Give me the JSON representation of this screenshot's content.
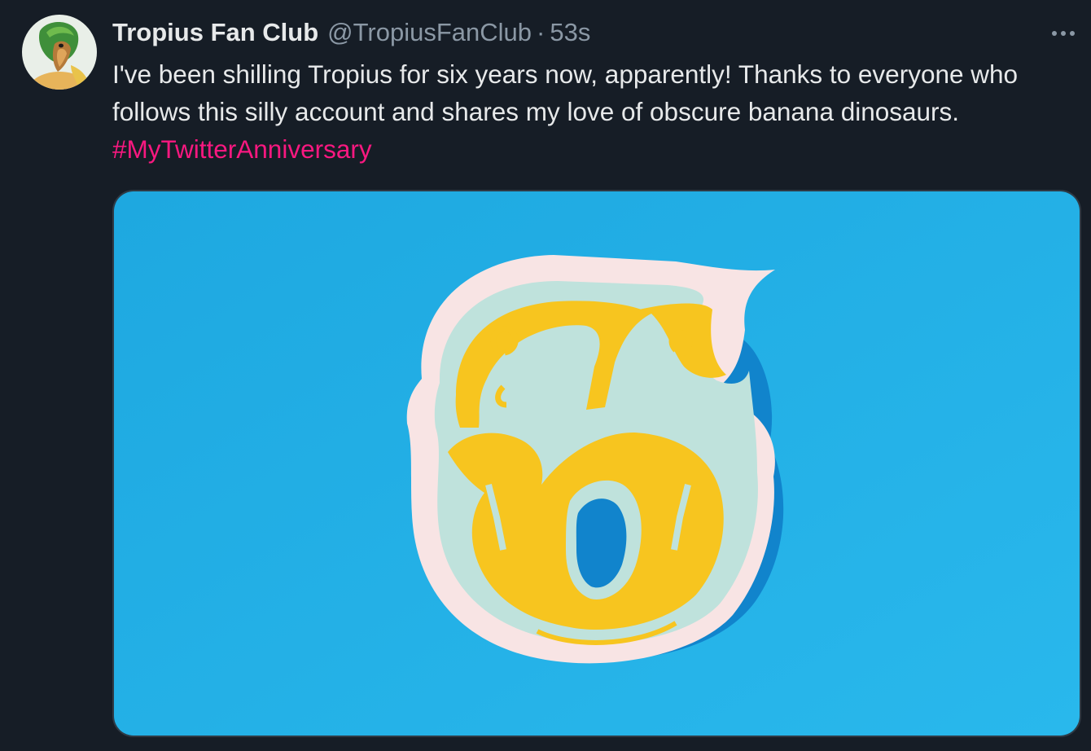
{
  "tweet": {
    "display_name": "Tropius Fan Club",
    "handle": "@TropiusFanClub",
    "separator": "·",
    "time": "53s",
    "avatar_icon": "tropius-avatar-icon",
    "more_icon": "more-options-icon",
    "text_main": "I've been shilling Tropius for six years now, apparently! Thanks to everyone who follows this silly account and shares my love of obscure banana dinosaurs. ",
    "hashtag": "#MyTwitterAnniversary",
    "media": {
      "icon": "paper-cut-number-six-image",
      "background_color": "#22b0e6",
      "accent_color": "#fbcb2a"
    }
  },
  "colors": {
    "background": "#161d26",
    "text_primary": "#e7e9ea",
    "text_secondary": "#8b98a5",
    "hashtag": "#f91880"
  }
}
